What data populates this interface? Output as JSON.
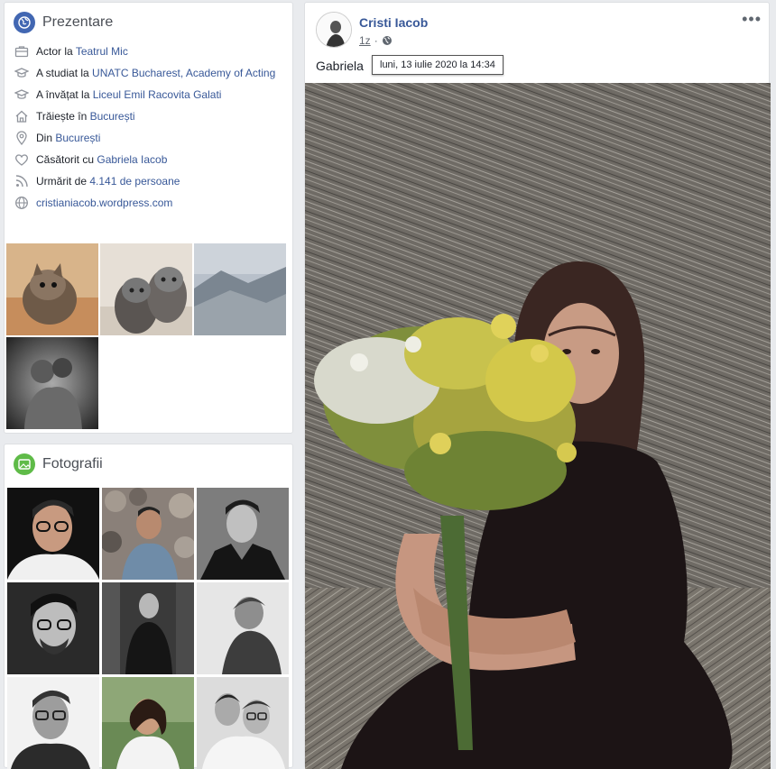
{
  "intro": {
    "title": "Prezentare",
    "rows": [
      {
        "icon": "briefcase-icon",
        "prefix": "Actor la ",
        "link": "Teatrul Mic"
      },
      {
        "icon": "graduation-cap-icon",
        "prefix": "A studiat la ",
        "link": "UNATC Bucharest, Academy of Acting"
      },
      {
        "icon": "graduation-cap-icon",
        "prefix": "A învățat la ",
        "link": "Liceul Emil Racovita Galati"
      },
      {
        "icon": "home-icon",
        "prefix": "Trăiește în ",
        "link": "București"
      },
      {
        "icon": "location-pin-icon",
        "prefix": "Din ",
        "link": "București"
      },
      {
        "icon": "heart-icon",
        "prefix": "Căsătorit cu ",
        "link": "Gabriela Iacob"
      },
      {
        "icon": "rss-icon",
        "prefix": "Urmărit de ",
        "link": "4.141 de persoane"
      },
      {
        "icon": "globe-icon",
        "prefix": "",
        "link": "cristianiacob.wordpress.com"
      }
    ]
  },
  "photos": {
    "title": "Fotografii"
  },
  "post": {
    "author": "Cristi Iacob",
    "time": "1z",
    "caption": "Gabriela",
    "tooltip": "luni, 13 iulie 2020 la 14:34",
    "more": "•••"
  },
  "colors": {
    "link": "#385898",
    "intro_icon_bg": "#4267b2",
    "photos_icon_bg": "#5fbb48"
  }
}
